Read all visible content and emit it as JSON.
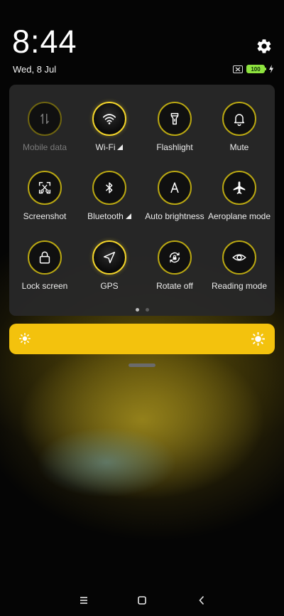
{
  "status": {
    "time": "8:44",
    "date": "Wed, 8 Jul",
    "battery": "100",
    "icons": [
      "settings-gear-icon",
      "no-sim-icon",
      "battery-icon",
      "charging-bolt-icon"
    ]
  },
  "tiles": [
    {
      "label": "Mobile data",
      "icon": "mobile-data-icon",
      "state": "disabled"
    },
    {
      "label": "Wi-Fi",
      "icon": "wifi-icon",
      "state": "on",
      "has_more": true
    },
    {
      "label": "Flashlight",
      "icon": "flashlight-icon",
      "state": "off"
    },
    {
      "label": "Mute",
      "icon": "bell-icon",
      "state": "off"
    },
    {
      "label": "Screenshot",
      "icon": "screenshot-scissors-icon",
      "state": "off"
    },
    {
      "label": "Bluetooth",
      "icon": "bluetooth-icon",
      "state": "off",
      "has_more": true
    },
    {
      "label": "Auto brightness",
      "icon": "auto-brightness-icon",
      "state": "off"
    },
    {
      "label": "Aeroplane mode",
      "icon": "airplane-icon",
      "state": "off"
    },
    {
      "label": "Lock screen",
      "icon": "lock-icon",
      "state": "off"
    },
    {
      "label": "GPS",
      "icon": "location-arrow-icon",
      "state": "on"
    },
    {
      "label": "Rotate off",
      "icon": "rotate-lock-icon",
      "state": "off"
    },
    {
      "label": "Reading mode",
      "icon": "eye-icon",
      "state": "off"
    }
  ],
  "pager": {
    "pages": 2,
    "current": 1
  },
  "brightness": {
    "icon_left": "sun-small-icon",
    "icon_right": "sun-large-icon"
  },
  "nav": {
    "buttons": [
      "menu-icon",
      "home-icon",
      "back-icon"
    ]
  },
  "colors": {
    "accent": "#f3c20d",
    "panel": "#282828",
    "ring": "#b9a712"
  }
}
